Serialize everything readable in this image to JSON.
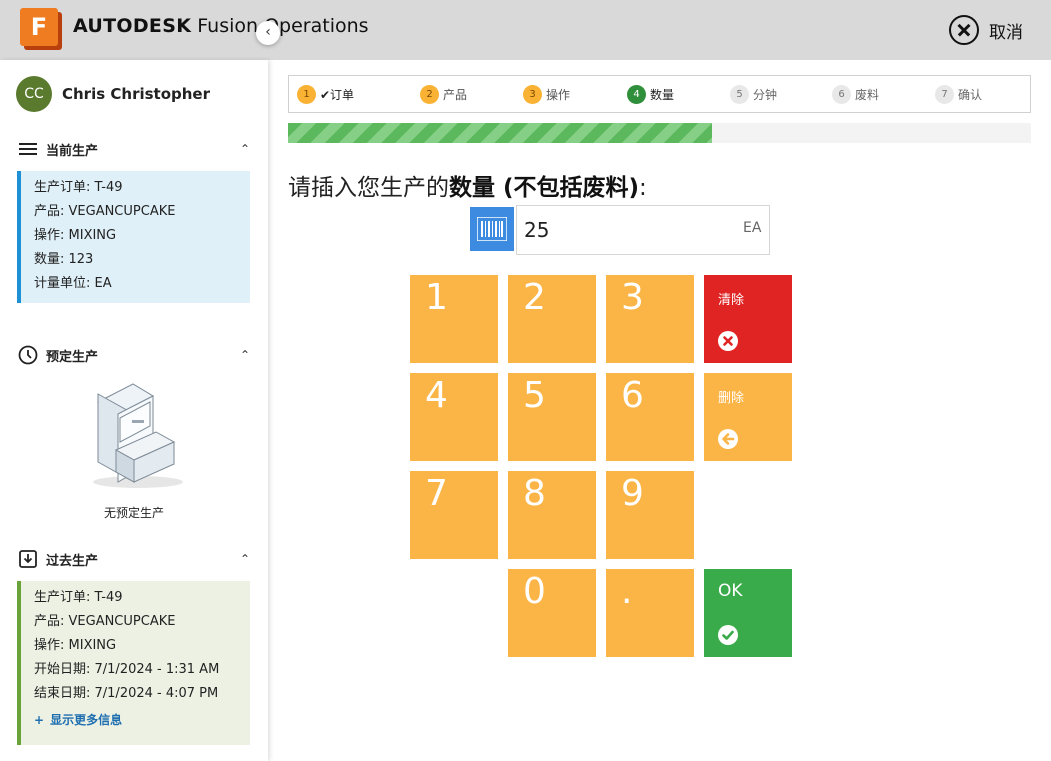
{
  "header": {
    "logo_letter": "F",
    "brand": "AUTODESK",
    "product": "Fusion Operations",
    "cancel_label": "取消",
    "cancel_icon": "close-circle-icon"
  },
  "sidebar": {
    "user": {
      "initials": "CC",
      "name": "Chris Christopher"
    },
    "collapse_icon": "chevron-left-icon",
    "current_production": {
      "title": "当前生产",
      "icon": "list-icon",
      "lines": [
        "生产订单: T-49",
        "产品: VEGANCUPCAKE",
        "操作: MIXING",
        "数量: 123",
        "计量单位: EA"
      ]
    },
    "scheduled_production": {
      "title": "预定生产",
      "icon": "clock-icon",
      "empty_text": "无预定生产"
    },
    "past_production": {
      "title": "过去生产",
      "icon": "download-box-icon",
      "lines": [
        "生产订单: T-49",
        "产品: VEGANCUPCAKE",
        "操作: MIXING",
        "开始日期: 7/1/2024 - 1:31 AM",
        "结束日期: 7/1/2024 - 4:07 PM"
      ],
      "more_label": "显示更多信息"
    }
  },
  "stepper": {
    "steps": [
      {
        "num": "1",
        "label": "✔订单",
        "state": "done"
      },
      {
        "num": "2",
        "label": "产品",
        "state": "done"
      },
      {
        "num": "3",
        "label": "操作",
        "state": "done"
      },
      {
        "num": "4",
        "label": "数量",
        "state": "current"
      },
      {
        "num": "5",
        "label": "分钟",
        "state": "future"
      },
      {
        "num": "6",
        "label": "废料",
        "state": "future"
      },
      {
        "num": "7",
        "label": "确认",
        "state": "future"
      }
    ],
    "progress_fraction": 0.57
  },
  "main": {
    "prompt_prefix": "请插入您生产的",
    "prompt_bold": "数量 (不包括废料)",
    "prompt_suffix": ":",
    "quantity_value": "25",
    "unit": "EA",
    "barcode_icon": "barcode-icon"
  },
  "keypad": {
    "keys": [
      "1",
      "2",
      "3",
      "4",
      "5",
      "6",
      "7",
      "8",
      "9",
      "0",
      "."
    ],
    "clear_label": "清除",
    "delete_label": "删除",
    "ok_label": "OK"
  },
  "colors": {
    "key_orange": "#fbb446",
    "clear_red": "#e02424",
    "ok_green": "#3aab4a",
    "accent_blue": "#3d8be0"
  }
}
